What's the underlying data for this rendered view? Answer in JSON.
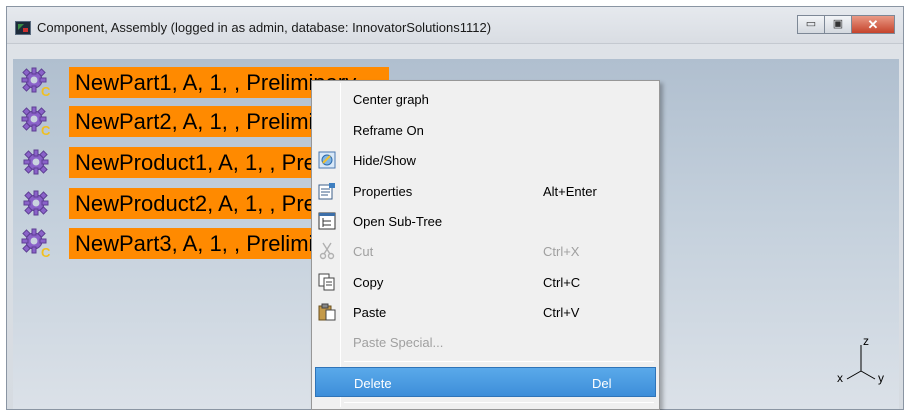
{
  "window": {
    "title": "Component, Assembly (logged in as admin, database: InnovatorSolutions1112)",
    "minimize_glyph": "▭",
    "maximize_glyph": "▣",
    "close_glyph": "✕"
  },
  "tree": {
    "nodes": [
      {
        "label": "NewPart1, A, 1, , Preliminary",
        "icon": "gear-c-icon"
      },
      {
        "label": "NewPart2, A, 1, , Preliminary",
        "icon": "gear-c-icon"
      },
      {
        "label": "NewProduct1, A, 1, , Preliminary",
        "icon": "gear-icon"
      },
      {
        "label": "NewProduct2, A, 1, , Preliminary",
        "icon": "gear-icon"
      },
      {
        "label": "NewPart3, A, 1, , Preliminary",
        "icon": "gear-c-icon"
      }
    ]
  },
  "axis": {
    "z": "z",
    "x": "x",
    "y": "y"
  },
  "context_menu": {
    "items": [
      {
        "label": "Center graph",
        "shortcut": "",
        "icon": "",
        "disabled": false
      },
      {
        "label": "Reframe On",
        "shortcut": "",
        "icon": "",
        "disabled": false
      },
      {
        "label": "Hide/Show",
        "shortcut": "",
        "icon": "hide-show-icon",
        "disabled": false
      },
      {
        "label": "Properties",
        "shortcut": "Alt+Enter",
        "icon": "properties-icon",
        "disabled": false
      },
      {
        "label": "Open Sub-Tree",
        "shortcut": "",
        "icon": "subtree-icon",
        "disabled": false
      },
      {
        "label": "Cut",
        "shortcut": "Ctrl+X",
        "icon": "scissors-icon",
        "disabled": true
      },
      {
        "label": "Copy",
        "shortcut": "Ctrl+C",
        "icon": "copy-icon",
        "disabled": false
      },
      {
        "label": "Paste",
        "shortcut": "Ctrl+V",
        "icon": "paste-icon",
        "disabled": false
      },
      {
        "label": "Paste Special...",
        "shortcut": "",
        "icon": "",
        "disabled": true
      },
      {
        "label": "Delete",
        "shortcut": "Del",
        "icon": "",
        "disabled": false,
        "highlighted": true
      }
    ]
  }
}
